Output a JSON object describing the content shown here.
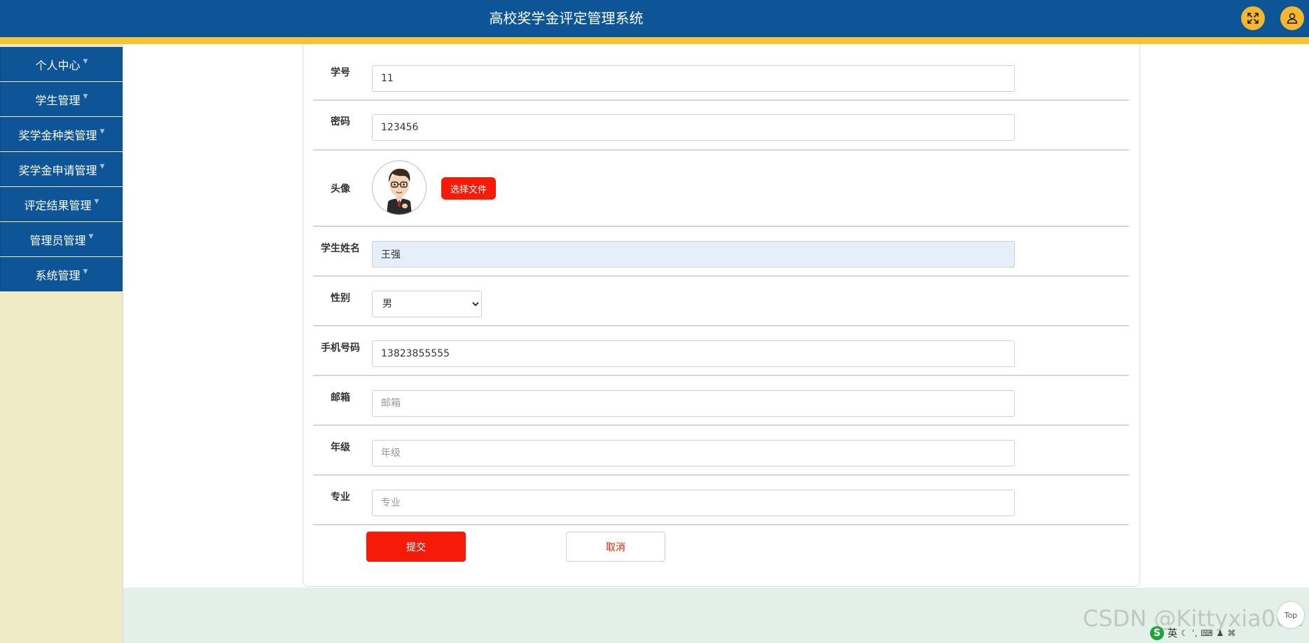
{
  "app": {
    "title": "高校奖学金评定管理系统"
  },
  "header": {
    "icons": [
      "fullscreen-icon",
      "user-icon"
    ],
    "colors": {
      "bar": "#0e5598",
      "stripe": "#f4c438",
      "icon_button": "#f5b72d"
    }
  },
  "sidebar": {
    "items": [
      {
        "label": "个人中心"
      },
      {
        "label": "学生管理"
      },
      {
        "label": "奖学金种类管理"
      },
      {
        "label": "奖学金申请管理"
      },
      {
        "label": "评定结果管理"
      },
      {
        "label": "管理员管理"
      },
      {
        "label": "系统管理"
      }
    ]
  },
  "form": {
    "student_id": {
      "label": "学号",
      "value": "11"
    },
    "password": {
      "label": "密码",
      "value": "123456"
    },
    "avatar": {
      "label": "头像",
      "upload_button": "选择文件"
    },
    "student_name": {
      "label": "学生姓名",
      "value": "王强"
    },
    "gender": {
      "label": "性别",
      "selected": "男"
    },
    "phone": {
      "label": "手机号码",
      "value": "13823855555"
    },
    "email": {
      "label": "邮箱",
      "placeholder": "邮箱"
    },
    "grade": {
      "label": "年级",
      "placeholder": "年级"
    },
    "major": {
      "label": "专业",
      "placeholder": "专业"
    },
    "submit_label": "提交",
    "cancel_label": "取消"
  },
  "overlay": {
    "watermark": "CSDN @Kittyxia001",
    "top_button": "Top",
    "ime_label": "英"
  },
  "colors": {
    "accent_red": "#f51b08",
    "sidebar_bg": "#efebc4",
    "footer_bg": "#e3efe9"
  }
}
